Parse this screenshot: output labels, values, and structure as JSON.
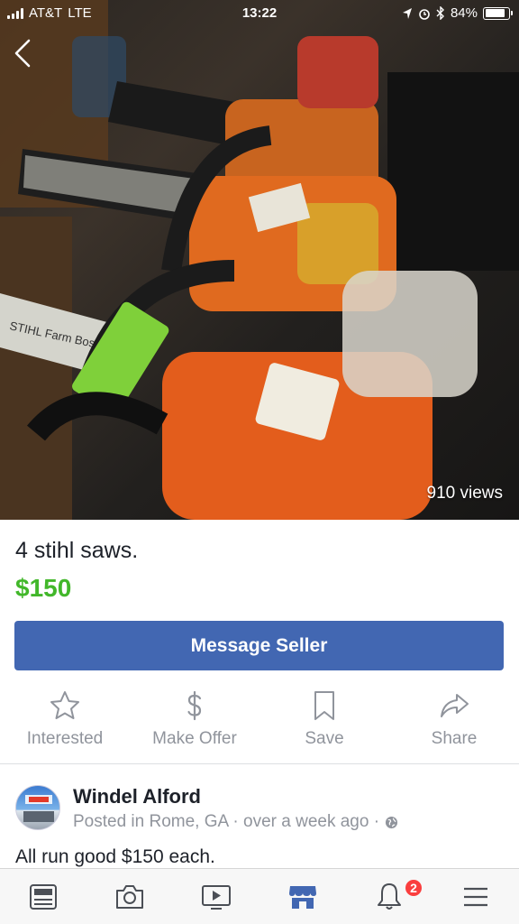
{
  "status_bar": {
    "carrier": "AT&T",
    "network": "LTE",
    "time": "13:22",
    "battery": "84%",
    "battery_level": 0.84
  },
  "photo": {
    "views": "910 views",
    "label_text": "STIHL Farm Boss"
  },
  "listing": {
    "title": "4 stihl saws.",
    "price": "$150",
    "message_button": "Message Seller",
    "description": "All run good  $150 each."
  },
  "actions": [
    {
      "label": "Interested",
      "icon": "star-icon"
    },
    {
      "label": "Make Offer",
      "icon": "dollar-icon"
    },
    {
      "label": "Save",
      "icon": "bookmark-icon"
    },
    {
      "label": "Share",
      "icon": "share-icon"
    }
  ],
  "seller": {
    "name": "Windel Alford",
    "meta": "Posted in Rome, GA · over a week ago ·"
  },
  "tabbar": {
    "items": [
      "news-feed-icon",
      "camera-icon",
      "watch-icon",
      "marketplace-icon",
      "notifications-icon",
      "menu-icon"
    ],
    "notifications_badge": "2",
    "active_color": "#4267b2"
  },
  "colors": {
    "accent": "#4267b2",
    "price": "#42b72a",
    "muted": "#90949c"
  }
}
